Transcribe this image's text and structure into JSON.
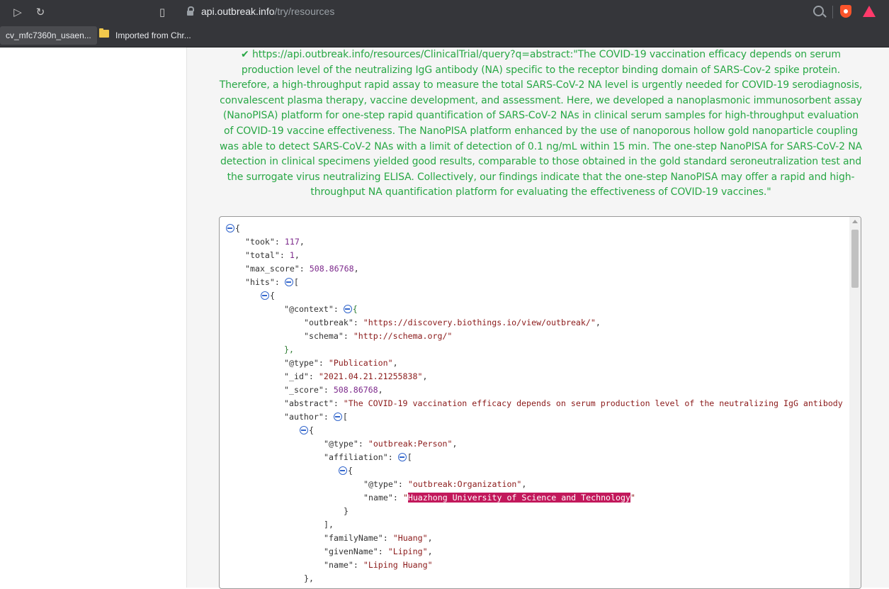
{
  "browser": {
    "url_host": "api.outbreak.info",
    "url_path": "/try/resources",
    "bookmarks": [
      "cv_mfc7360n_usaen...",
      "Imported from Chr..."
    ]
  },
  "result": {
    "query_url": "https://api.outbreak.info/resources/ClinicalTrial/query?q=abstract:\"The COVID-19 vaccination efficacy depends on serum production level of the neutralizing IgG antibody (NA) specific to the receptor binding domain of SARS-Cov-2 spike protein. Therefore, a high-throughput rapid assay to measure the total SARS-CoV-2 NA level is urgently needed for COVID-19 serodiagnosis, convalescent plasma therapy, vaccine development, and assessment. Here, we developed a nanoplasmonic immunosorbent assay (NanoPISA) platform for one-step rapid quantification of SARS-CoV-2 NAs in clinical serum samples for high-throughput evaluation of COVID-19 vaccine effectiveness. The NanoPISA platform enhanced by the use of nanoporous hollow gold nanoparticle coupling was able to detect SARS-CoV-2 NAs with a limit of detection of 0.1 ng/mL within 15 min. The one-step NanoPISA for SARS-CoV-2 NA detection in clinical specimens yielded good results, comparable to those obtained in the gold standard seroneutralization test and the surrogate virus neutralizing ELISA. Collectively, our findings indicate that the one-step NanoPISA may offer a rapid and high-throughput NA quantification platform for evaluating the effectiveness of COVID-19 vaccines.\"",
    "status_color": "#28a745"
  },
  "json": {
    "took_key": "\"took\"",
    "took": "117",
    "total_key": "\"total\"",
    "total": "1",
    "max_score_key": "\"max_score\"",
    "max_score": "508.86768",
    "hits_key": "\"hits\"",
    "context_key": "\"@context\"",
    "outbreak_key": "\"outbreak\"",
    "outbreak": "\"https://discovery.biothings.io/view/outbreak/\"",
    "schema_key": "\"schema\"",
    "schema": "\"http://schema.org/\"",
    "type_key": "\"@type\"",
    "type": "\"Publication\"",
    "id_key": "\"_id\"",
    "id": "\"2021.04.21.21255838\"",
    "score_key": "\"_score\"",
    "score": "508.86768",
    "abstract_key": "\"abstract\"",
    "abstract": "\"The COVID-19 vaccination efficacy depends on serum production level of the neutralizing IgG antibody",
    "author_key": "\"author\"",
    "person_type_key": "\"@type\"",
    "person_type": "\"outbreak:Person\"",
    "affiliation_key": "\"affiliation\"",
    "org_type_key": "\"@type\"",
    "org_type": "\"outbreak:Organization\"",
    "org_name_key": "\"name\"",
    "org_name_q1": "\"",
    "org_name": "Huazhong University of Science and Technology",
    "org_name_q2": "\"",
    "family_key": "\"familyName\"",
    "family": "\"Huang\"",
    "given_key": "\"givenName\"",
    "given": "\"Liping\"",
    "pname_key": "\"name\"",
    "pname": "\"Liping Huang\""
  }
}
